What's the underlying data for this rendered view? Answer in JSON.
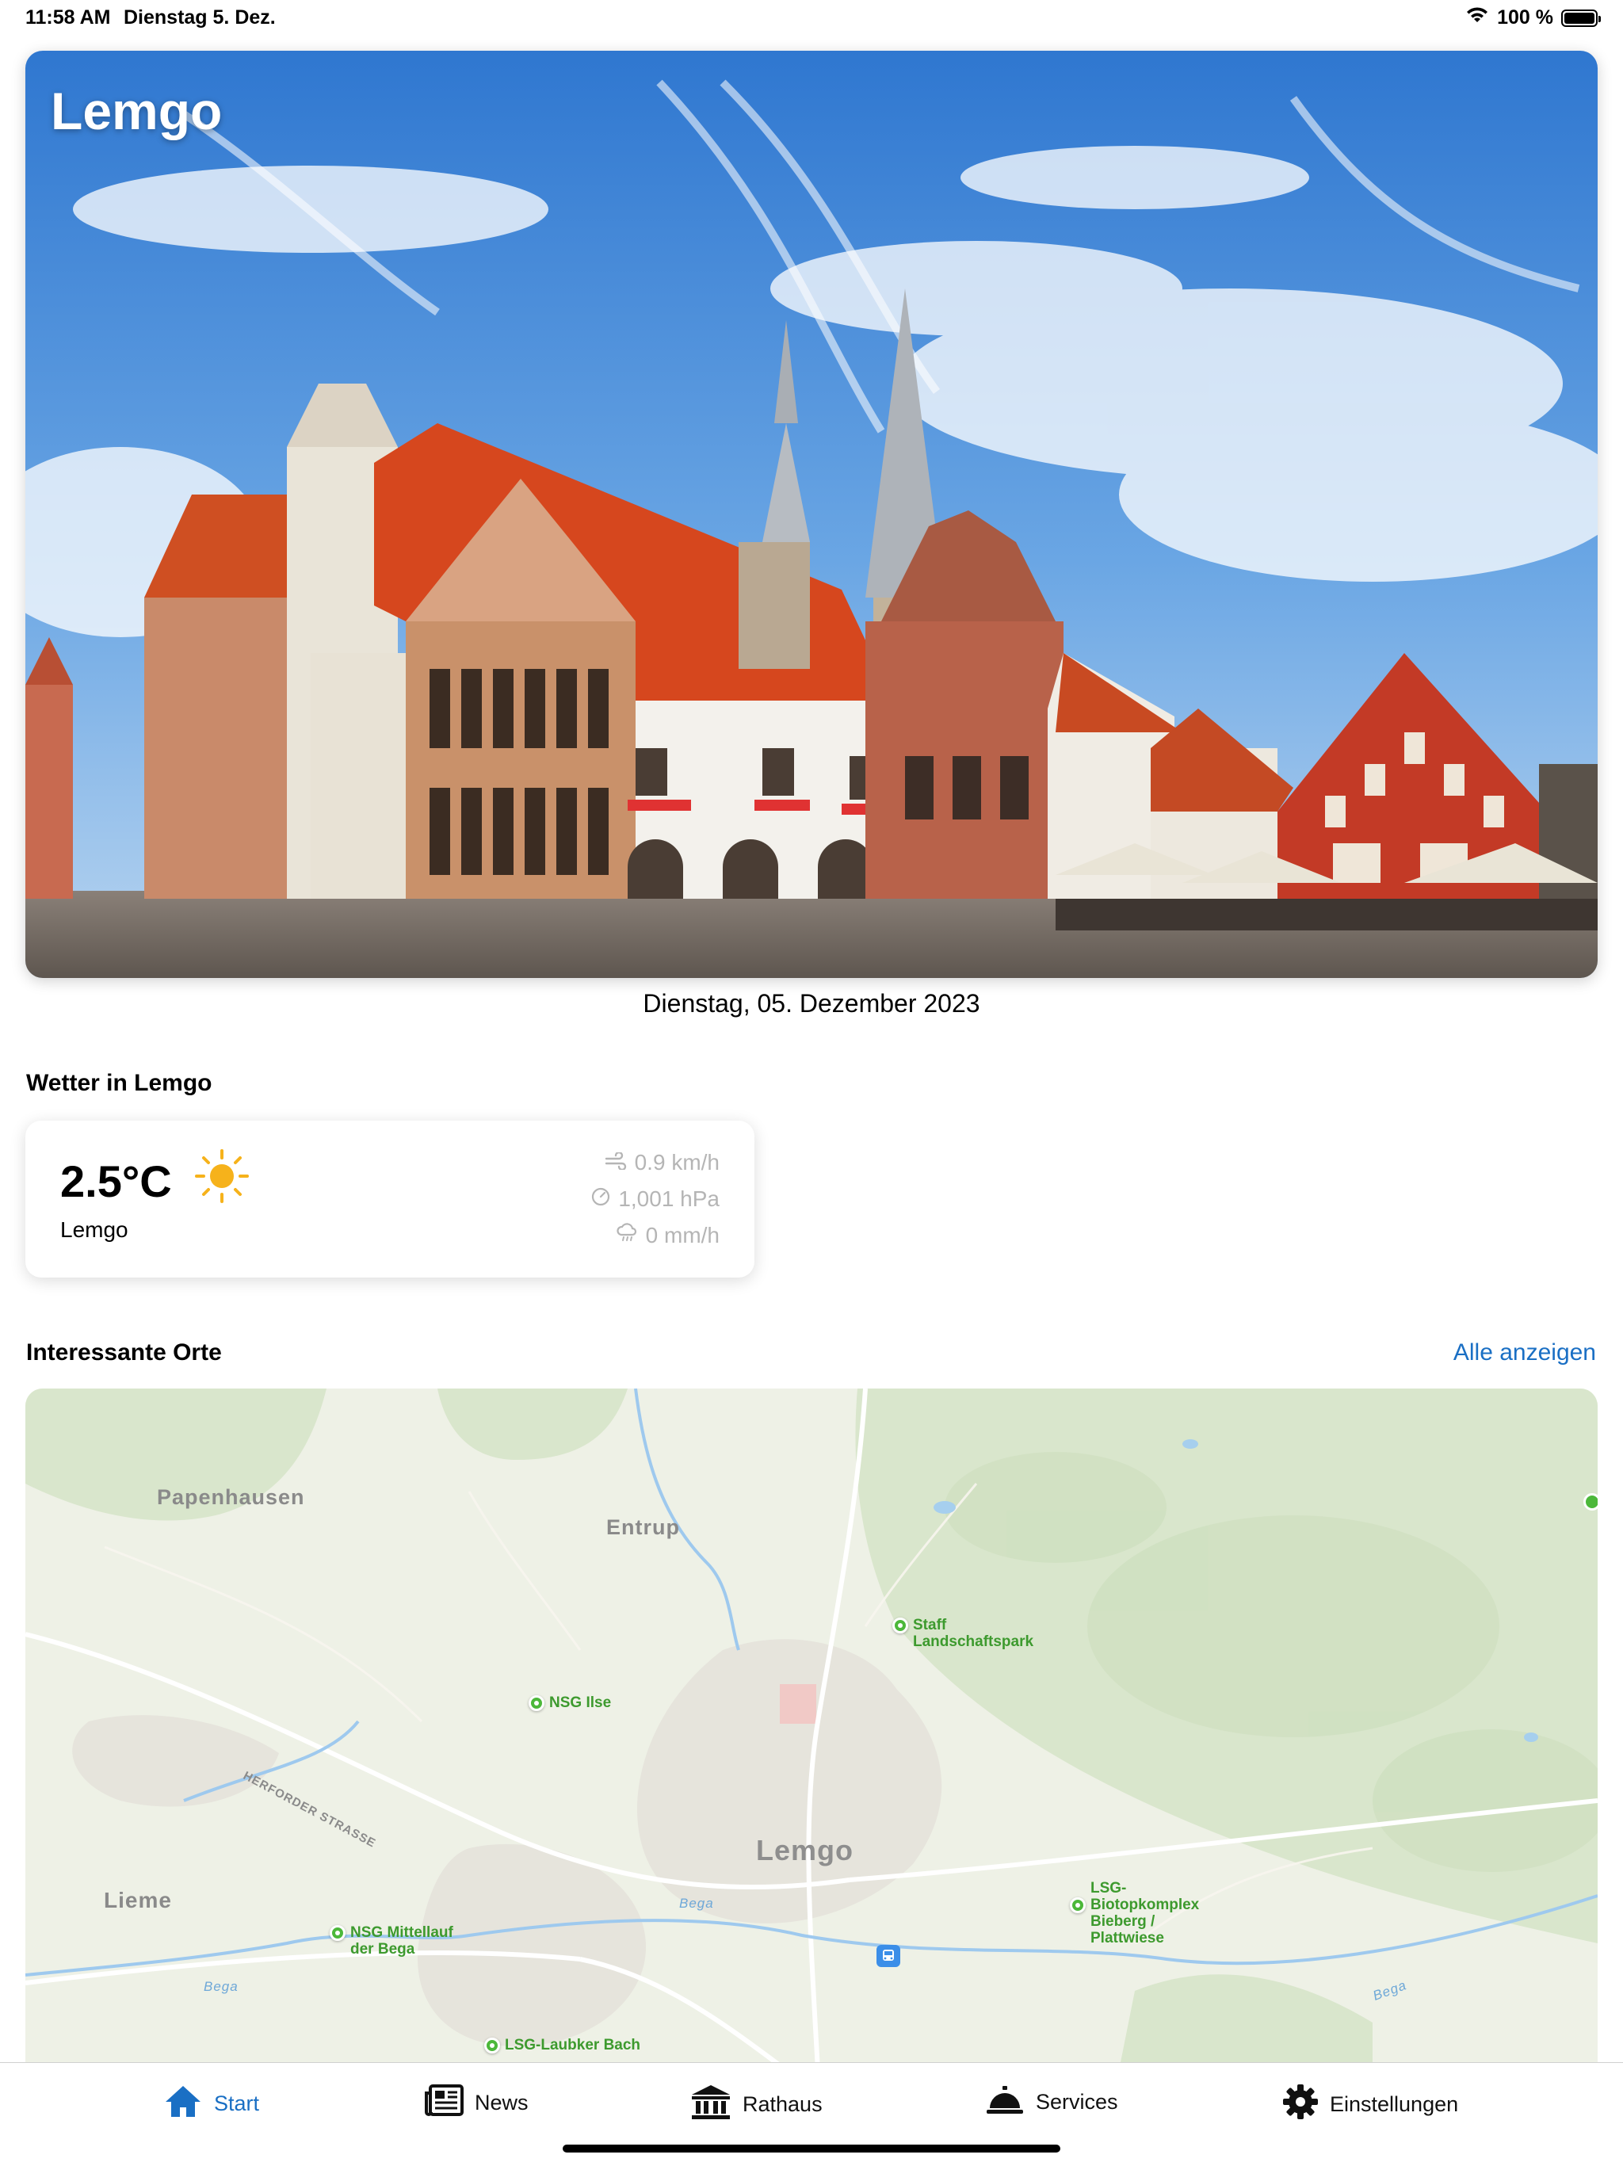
{
  "status_bar": {
    "time": "11:58 AM",
    "date": "Dienstag 5. Dez.",
    "battery": "100 %",
    "battery_level": 1.0
  },
  "hero": {
    "title": "Lemgo"
  },
  "date_line": "Dienstag, 05. Dezember 2023",
  "weather": {
    "section_title": "Wetter in Lemgo",
    "temperature": "2.5°C",
    "place": "Lemgo",
    "wind": "0.9 km/h",
    "pressure": "1,001 hPa",
    "rain": "0 mm/h",
    "icon": "sun-icon"
  },
  "places": {
    "section_title": "Interessante Orte",
    "show_all": "Alle anzeigen"
  },
  "map": {
    "labels": {
      "papenhausen": "Papenhausen",
      "entrup": "Entrup",
      "lieme": "Lieme",
      "lemgo": "Lemgo",
      "street": "HERFORDER STRASSE",
      "bega1": "Bega",
      "bega2": "Bega",
      "bega3": "Bega"
    },
    "pois": [
      {
        "name": "Staff\nLandschaftspark"
      },
      {
        "name": "NSG Ilse"
      },
      {
        "name": "LSG-\nBiotopkomplex\nBieberg /\nPlattwiese"
      },
      {
        "name": "NSG Mittellauf\nder Bega"
      },
      {
        "name": "LSG-Laubker Bach"
      }
    ]
  },
  "tabs": [
    {
      "label": "Start",
      "icon": "home-icon",
      "active": true
    },
    {
      "label": "News",
      "icon": "newspaper-icon"
    },
    {
      "label": "Rathaus",
      "icon": "townhall-icon"
    },
    {
      "label": "Services",
      "icon": "service-bell-icon"
    },
    {
      "label": "Einstellungen",
      "icon": "gear-icon"
    }
  ],
  "colors": {
    "accent": "#1a6fc4",
    "poi_green": "#4cb83a",
    "map_bg": "#eef1e6"
  }
}
